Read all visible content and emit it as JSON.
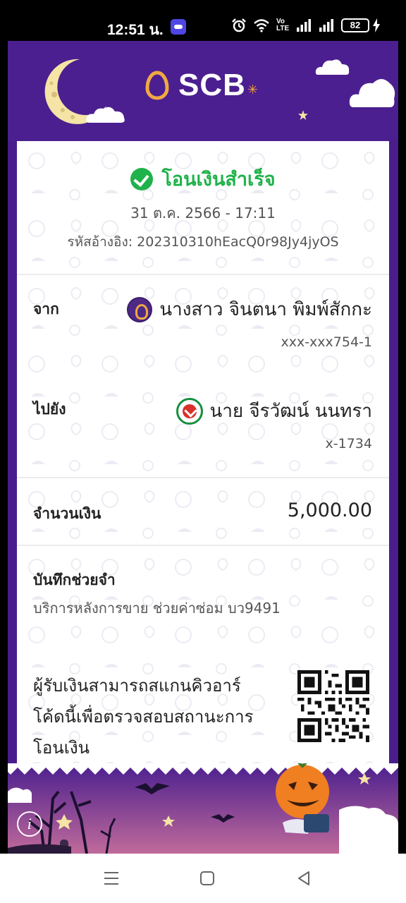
{
  "status_bar": {
    "time": "12:51 น.",
    "battery": "82",
    "volte": "Vo LTE"
  },
  "app": {
    "brand": "SCB",
    "colors": {
      "header": "#4b1f8f",
      "success": "#1fb24a",
      "text": "#222222",
      "muted": "#555555"
    }
  },
  "receipt": {
    "status": "โอนเงินสำเร็จ",
    "datetime": "31 ต.ค. 2566 - 17:11",
    "reference": "รหัสอ้างอิง: 202310310hEacQ0r98Jy4jyOS",
    "from": {
      "label": "จาก",
      "name": "นางสาว จินตนา พิมพ์สักกะ",
      "account": "xxx-xxx754-1",
      "bank_icon": "scb-bank-icon"
    },
    "to": {
      "label": "ไปยัง",
      "name": "นาย จีรวัฒน์ นนทรา",
      "account": "x-1734",
      "bank_icon": "kbank-bank-icon"
    },
    "amount": {
      "label": "จำนวนเงิน",
      "value": "5,000.00"
    },
    "memo": {
      "label": "บันทึกช่วยจำ",
      "value": "บริการหลังการขาย ช่วยค่าซ่อม บว9491"
    },
    "qr_note": "ผู้รับเงินสามารถสแกนคิวอาร์โค้ดนี้เพื่อตรวจสอบสถานะการโอนเงิน"
  },
  "nav": {
    "icons": [
      "menu-icon",
      "home-icon",
      "back-icon"
    ]
  }
}
